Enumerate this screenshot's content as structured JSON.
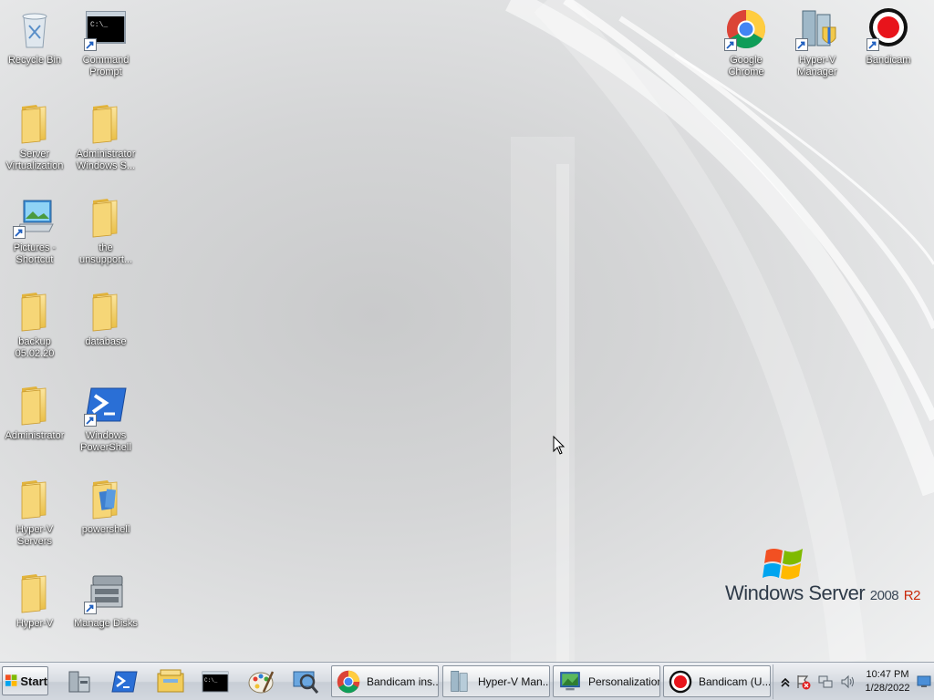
{
  "desktop": {
    "icons": [
      {
        "label": "Recycle Bin",
        "icon": "recycle-bin-icon"
      },
      {
        "label": "Command Prompt",
        "icon": "command-prompt-icon"
      },
      {
        "label": "Server Virtualization",
        "icon": "folder-icon"
      },
      {
        "label": "Administrator Windows S...",
        "icon": "folder-icon"
      },
      {
        "label": "Pictures - Shortcut",
        "icon": "pictures-shortcut-icon"
      },
      {
        "label": "the unsupport...",
        "icon": "folder-icon"
      },
      {
        "label": "backup 05.02.20",
        "icon": "folder-icon"
      },
      {
        "label": "database",
        "icon": "folder-icon"
      },
      {
        "label": "Administrator",
        "icon": "folder-icon"
      },
      {
        "label": "Windows PowerShell",
        "icon": "powershell-icon"
      },
      {
        "label": "Hyper-V Servers",
        "icon": "folder-icon"
      },
      {
        "label": "powershell",
        "icon": "folder-documents-icon"
      },
      {
        "label": "Hyper-V",
        "icon": "folder-icon"
      },
      {
        "label": "Manage Disks",
        "icon": "disk-management-icon"
      },
      {
        "label": "Google Chrome",
        "icon": "chrome-icon"
      },
      {
        "label": "Hyper-V Manager",
        "icon": "hyperv-manager-icon"
      },
      {
        "label": "Bandicam",
        "icon": "bandicam-icon"
      }
    ],
    "brand": {
      "name": "Windows Server",
      "version": "2008",
      "edition": "R2"
    }
  },
  "taskbar": {
    "start_label": "Start",
    "quick_launch": [
      "server-manager-icon",
      "powershell-icon",
      "explorer-icon",
      "command-prompt-icon",
      "paint-icon",
      "magnifier-icon"
    ],
    "buttons": [
      {
        "label": "Bandicam ins...",
        "icon": "chrome-icon"
      },
      {
        "label": "Hyper-V Man...",
        "icon": "hyperv-manager-icon"
      },
      {
        "label": "Personalization",
        "icon": "personalization-icon"
      },
      {
        "label": "Bandicam (U...",
        "icon": "bandicam-icon"
      }
    ],
    "tray": {
      "icons": [
        "show-hidden-icons-icon",
        "action-center-warning-icon",
        "network-icon",
        "volume-icon",
        "show-desktop-icon"
      ],
      "time": "10:47 PM",
      "date": "1/28/2022"
    }
  },
  "colors": {
    "taskbar": "#d3d8df",
    "desktop": "#d4d5d6",
    "bandicam_red": "#e8141b",
    "folder": "#f2cd5c"
  }
}
